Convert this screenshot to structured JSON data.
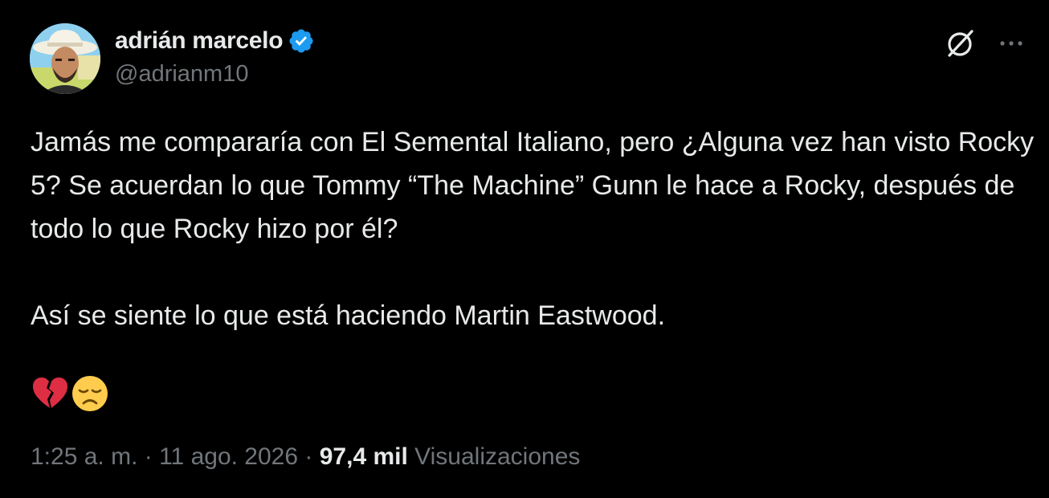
{
  "author": {
    "display_name": "adrián marcelo",
    "handle": "@adrianm10",
    "verified": true
  },
  "tweet": {
    "paragraphs": [
      "Jamás me compararía con El Semental Italiano, pero ¿Alguna vez han visto Rocky 5? Se acuerdan lo que Tommy “The Machine” Gunn le hace a Rocky, después de todo lo que Rocky hizo por él?",
      "Así se siente lo que está haciendo Martin Eastwood."
    ],
    "emojis": [
      "broken-heart-icon",
      "disappointed-face-icon"
    ]
  },
  "meta": {
    "time": "1:25 a. m.",
    "separator": "·",
    "date": "11 ago. 2026",
    "views_count": "97,4 mil",
    "views_label": "Visualizaciones"
  },
  "colors": {
    "background": "#000000",
    "primary_text": "#e7e9ea",
    "secondary_text": "#71767b",
    "verified_badge": "#1d9bf0"
  }
}
